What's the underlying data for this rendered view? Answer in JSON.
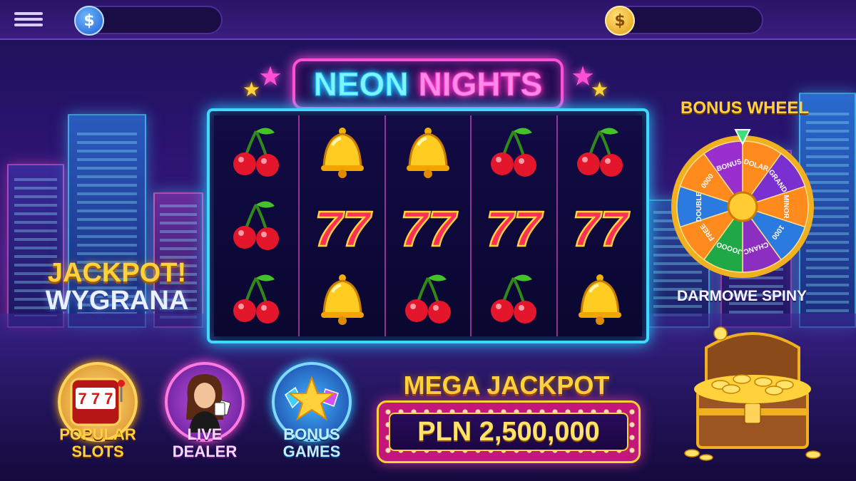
{
  "header": {
    "menu_icon": "hamburger-menu-icon",
    "balances": [
      {
        "currency_symbol": "$",
        "icon": "dollar-coin-icon",
        "value": ""
      },
      {
        "currency_symbol": "$",
        "icon": "gold-coin-icon",
        "value": ""
      }
    ]
  },
  "game": {
    "title_part1": "NEON",
    "title_part2": "NIGHTS",
    "reels": [
      [
        "cherry",
        "cherry",
        "cherry"
      ],
      [
        "bell",
        "seven",
        "bell"
      ],
      [
        "bell",
        "seven",
        "cherry"
      ],
      [
        "cherry",
        "seven",
        "cherry"
      ],
      [
        "cherry",
        "seven",
        "bell"
      ]
    ],
    "seven_text": "77"
  },
  "side_jackpot": {
    "line1": "JACKPOT!",
    "line2": "WYGRANA"
  },
  "bonus_wheel": {
    "title": "BONUS WHEEL",
    "caption": "DARMOWE SPINY",
    "segments": [
      {
        "label": "DOLAR",
        "color": "#ff8a1e"
      },
      {
        "label": "GRAND",
        "color": "#7a2fd0"
      },
      {
        "label": "MINOR",
        "color": "#ff8a1e"
      },
      {
        "label": "1000",
        "color": "#2a7ae0"
      },
      {
        "label": "CHANC",
        "color": "#8a2fc0"
      },
      {
        "label": "JOOOO",
        "color": "#1fa845"
      },
      {
        "label": "FREE",
        "color": "#ff8a1e"
      },
      {
        "label": "DOUBLE",
        "color": "#2a7ae0"
      },
      {
        "label": "0000",
        "color": "#ff8a1e"
      },
      {
        "label": "BONUS",
        "color": "#9a2fd0"
      }
    ],
    "colors": {
      "rim": "#f0b020",
      "pointer": "#3be07a"
    }
  },
  "categories": [
    {
      "label_line1": "POPULAR",
      "label_line2": "SLOTS",
      "icon": "slot-machine-icon",
      "reel_text": "7 7 7"
    },
    {
      "label_line1": "LIVE",
      "label_line2": "DEALER",
      "icon": "dealer-avatar-icon"
    },
    {
      "label_line1": "BONUS",
      "label_line2": "GAMES",
      "icon": "star-gems-icon"
    }
  ],
  "mega_jackpot": {
    "title": "MEGA JACKPOT",
    "value": "PLN 2,500,000"
  },
  "decor": {
    "treasure_icon": "treasure-chest-icon",
    "colors": {
      "neon_cyan": "#3fd9ff",
      "neon_pink": "#ff4fd8",
      "gold": "#ffd23b"
    }
  }
}
